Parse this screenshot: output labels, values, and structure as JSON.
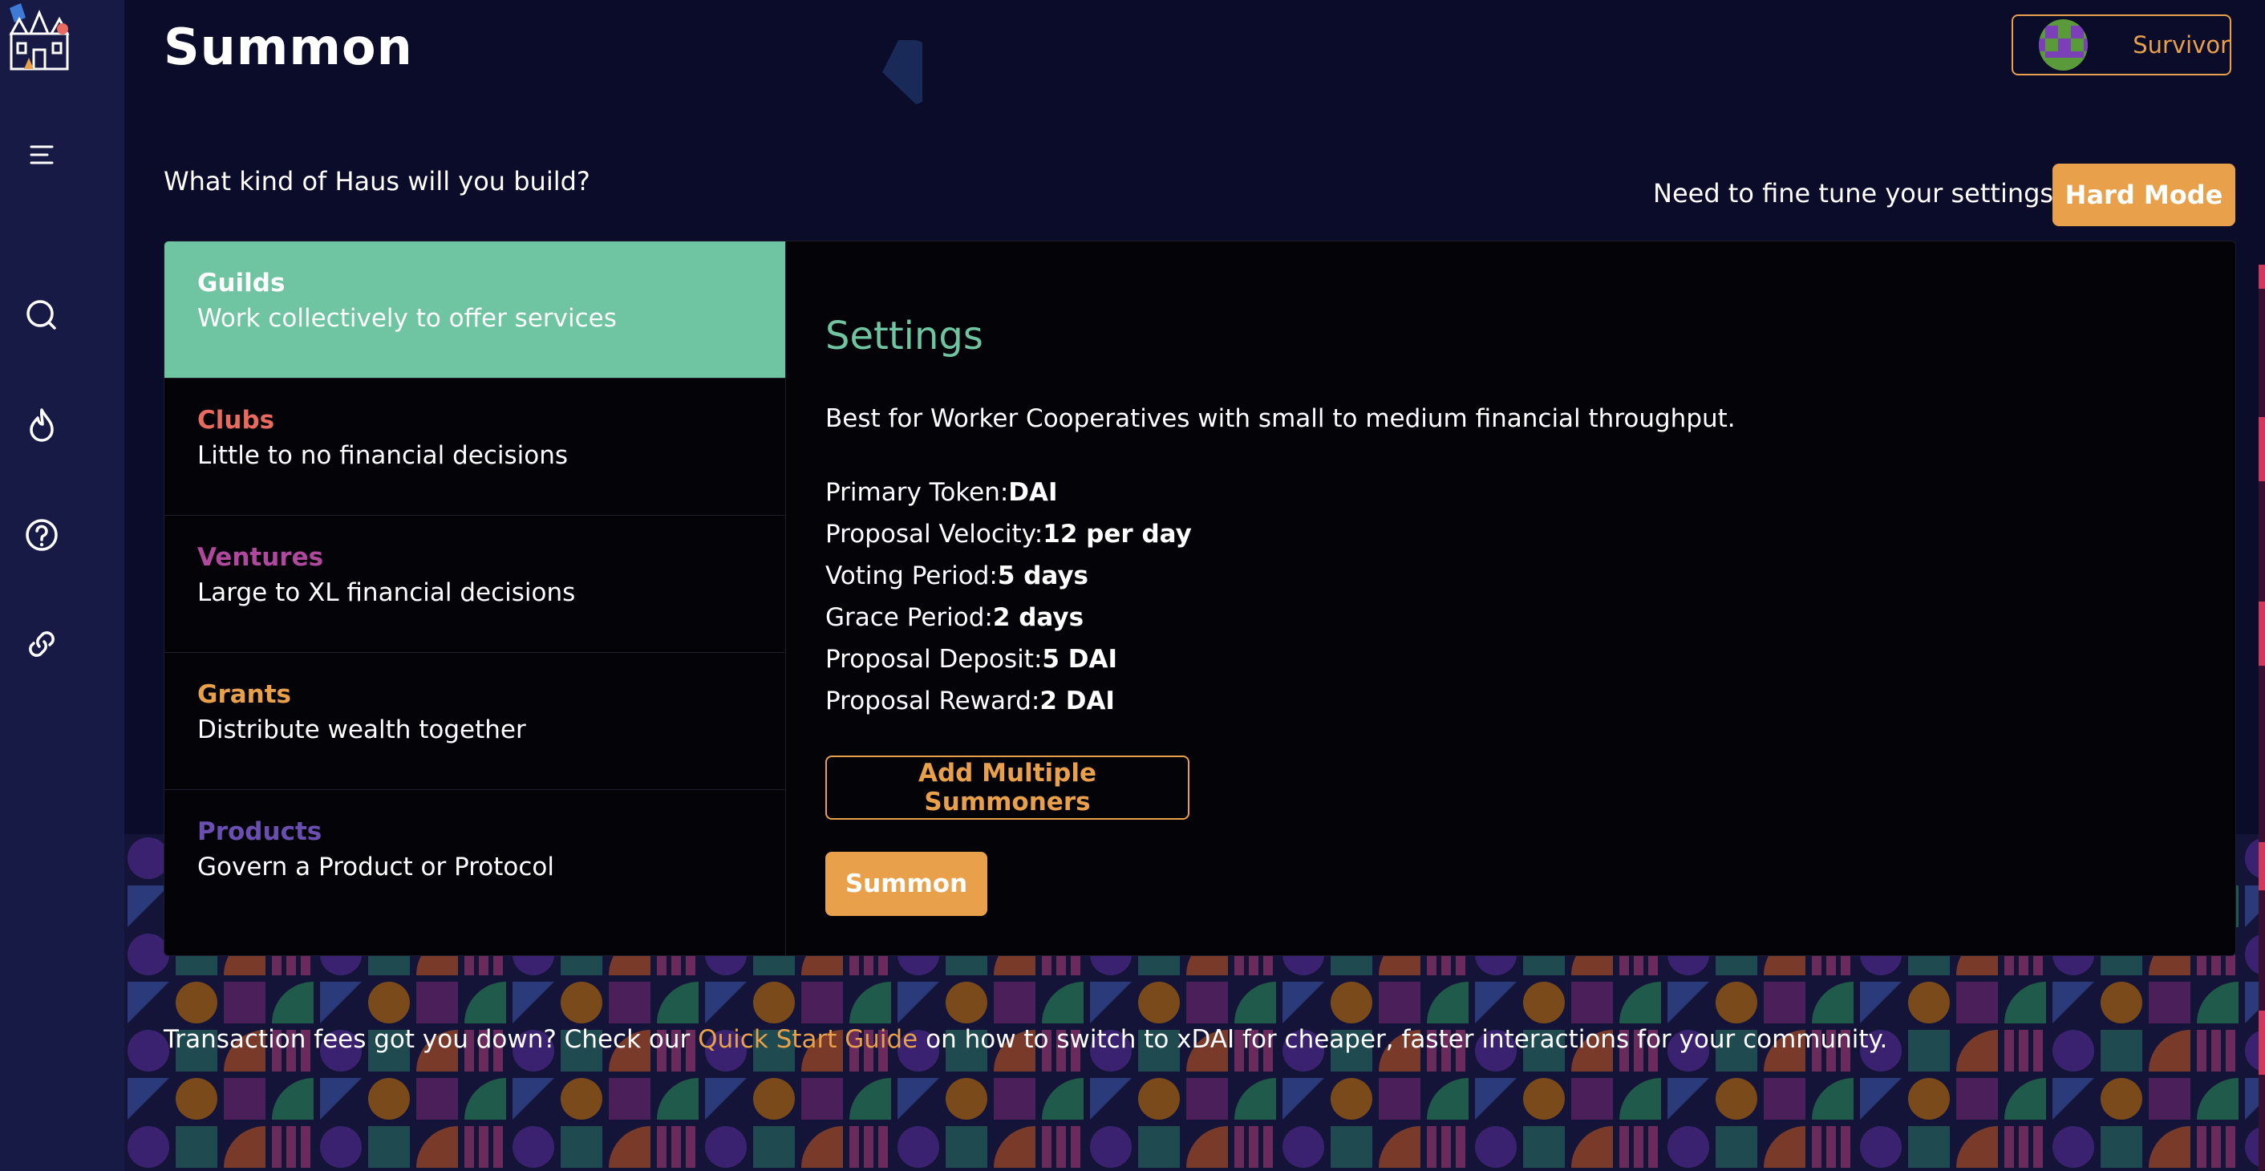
{
  "header": {
    "title": "Summon",
    "user_name": "Survivor"
  },
  "sidebar": {
    "icons": [
      "castle-logo",
      "menu-icon",
      "search-icon",
      "flame-icon",
      "help-icon",
      "link-icon"
    ]
  },
  "intro": {
    "question": "What kind of Haus will you build?",
    "finetune_text": "Need to fine tune your settings?",
    "hard_mode_label": "Hard Mode"
  },
  "categories": [
    {
      "title": "Guilds",
      "desc": "Work collectively to offer services",
      "color": "#ffffff",
      "selected": true
    },
    {
      "title": "Clubs",
      "desc": "Little to no financial decisions",
      "color": "#e96a5e",
      "selected": false
    },
    {
      "title": "Ventures",
      "desc": "Large to XL financial decisions",
      "color": "#b0489d",
      "selected": false
    },
    {
      "title": "Grants",
      "desc": "Distribute wealth together",
      "color": "#e8a14a",
      "selected": false
    },
    {
      "title": "Products",
      "desc": "Govern a Product or Protocol",
      "color": "#6a4fb0",
      "selected": false
    }
  ],
  "settings": {
    "title": "Settings",
    "description": "Best for Worker Cooperatives with small to medium financial throughput.",
    "specs": [
      {
        "label": "Primary Token:",
        "value": "DAI"
      },
      {
        "label": "Proposal Velocity:",
        "value": "12 per day"
      },
      {
        "label": "Voting Period:",
        "value": "5 days"
      },
      {
        "label": "Grace Period:",
        "value": "2 days"
      },
      {
        "label": "Proposal Deposit:",
        "value": "5 DAI"
      },
      {
        "label": "Proposal Reward:",
        "value": "2 DAI"
      }
    ],
    "add_summoners_label": "Add Multiple Summoners",
    "summon_label": "Summon"
  },
  "footer": {
    "pre": "Transaction fees got you down? Check our ",
    "link": "Quick Start Guide",
    "post": " on how to switch to xDAI for cheaper, faster interactions for your community."
  },
  "colors": {
    "accent": "#e8a14a",
    "selected_bg": "#6fc4a1",
    "sidebar": "#171a45",
    "background": "#0b0b2a"
  }
}
